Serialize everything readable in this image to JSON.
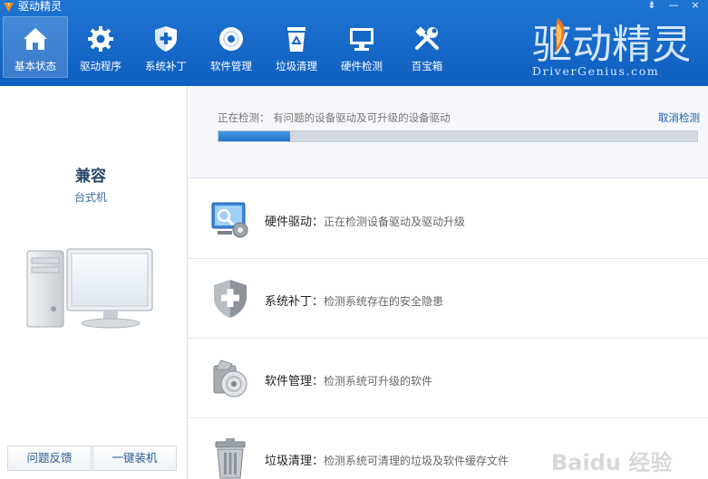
{
  "app": {
    "title": "驱动精灵"
  },
  "window": {
    "menu_glyph": "⇟",
    "minimize_glyph": "—",
    "close_glyph": "×"
  },
  "nav": [
    {
      "label": "基本状态",
      "icon": "home-icon",
      "active": true
    },
    {
      "label": "驱动程序",
      "icon": "gear-icon",
      "active": false
    },
    {
      "label": "系统补丁",
      "icon": "shield-icon",
      "active": false
    },
    {
      "label": "软件管理",
      "icon": "disc-icon",
      "active": false
    },
    {
      "label": "垃圾清理",
      "icon": "recycle-bin-icon",
      "active": false
    },
    {
      "label": "硬件检测",
      "icon": "monitor-icon",
      "active": false
    },
    {
      "label": "百宝箱",
      "icon": "tools-icon",
      "active": false
    }
  ],
  "brand": {
    "logo_text": "驱动精灵",
    "sub": "DriverGenius.com"
  },
  "computer": {
    "name": "兼容",
    "type": "台式机"
  },
  "left_buttons": {
    "feedback": "问题反馈",
    "install": "一键装机"
  },
  "scan": {
    "label": "正在检测：",
    "text": "有问题的设备驱动及可升级的设备驱动",
    "cancel": "取消检测",
    "progress": 0.15
  },
  "rows": [
    {
      "icon": "hardware-driver-icon",
      "title": "硬件驱动：",
      "desc": "正在检测设备驱动及驱动升级"
    },
    {
      "icon": "system-patch-shield-icon",
      "title": "系统补丁：",
      "desc": "检测系统存在的安全隐患"
    },
    {
      "icon": "software-manage-icon",
      "title": "软件管理：",
      "desc": "检测系统可升级的软件"
    },
    {
      "icon": "trash-icon",
      "title": "垃圾清理：",
      "desc": "检测系统可清理的垃圾及软件缓存文件"
    }
  ],
  "colors": {
    "topbar": "#1568c8",
    "progress": "#2a78d0",
    "accent_text": "#1a5fad"
  },
  "watermark": "Baidu 经验"
}
